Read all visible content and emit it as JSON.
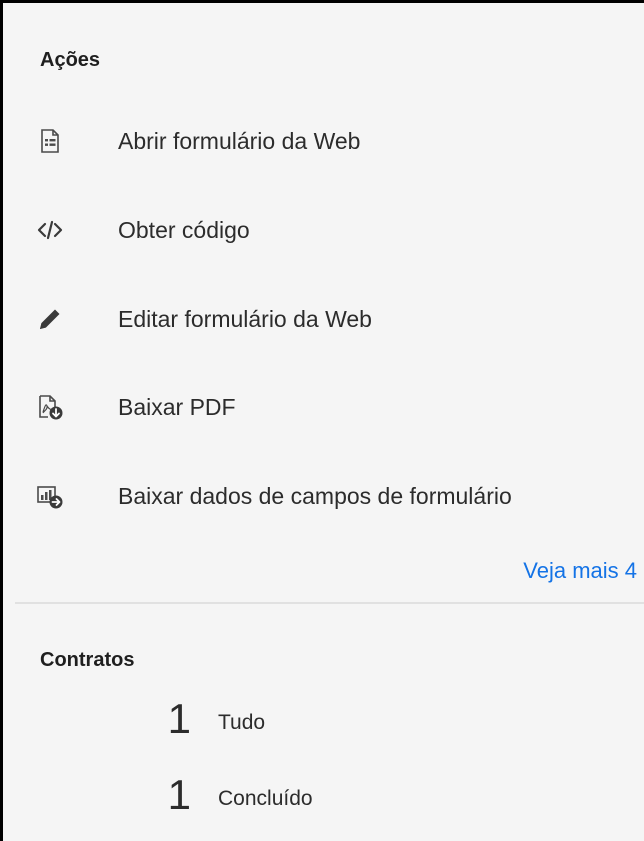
{
  "actions": {
    "title": "Ações",
    "items": [
      {
        "label": "Abrir formulário da Web",
        "icon": "form-document-icon"
      },
      {
        "label": "Obter código",
        "icon": "code-icon"
      },
      {
        "label": "Editar formulário da Web",
        "icon": "pencil-icon"
      },
      {
        "label": "Baixar PDF",
        "icon": "pdf-download-icon"
      },
      {
        "label": "Baixar dados de campos de formulário",
        "icon": "chart-download-icon"
      }
    ],
    "see_more": "Veja mais 4",
    "link_color": "#1473e6"
  },
  "contracts": {
    "title": "Contratos",
    "stats": [
      {
        "count": "1",
        "label": "Tudo"
      },
      {
        "count": "1",
        "label": "Concluído"
      }
    ]
  }
}
